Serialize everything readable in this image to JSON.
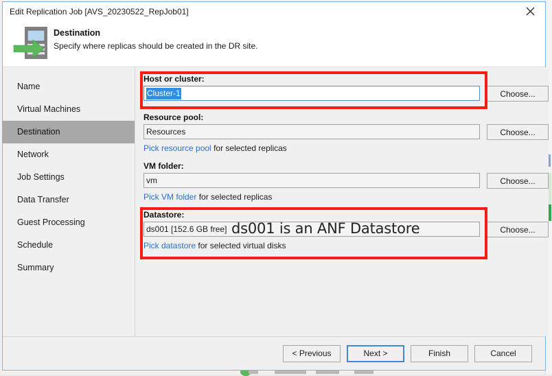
{
  "window": {
    "title": "Edit Replication Job [AVS_20230522_RepJob01]",
    "close_icon": "close-icon"
  },
  "header": {
    "icon": "replication-server-arrow-icon",
    "title": "Destination",
    "subtitle": "Specify where replicas should be created in the DR site."
  },
  "sidebar": {
    "items": [
      {
        "label": "Name",
        "active": false
      },
      {
        "label": "Virtual Machines",
        "active": false
      },
      {
        "label": "Destination",
        "active": true
      },
      {
        "label": "Network",
        "active": false
      },
      {
        "label": "Job Settings",
        "active": false
      },
      {
        "label": "Data Transfer",
        "active": false
      },
      {
        "label": "Guest Processing",
        "active": false
      },
      {
        "label": "Schedule",
        "active": false
      },
      {
        "label": "Summary",
        "active": false
      }
    ]
  },
  "form": {
    "host_cluster": {
      "label": "Host or cluster:",
      "value": "Cluster-1",
      "choose_label": "Choose...",
      "highlighted": true
    },
    "resource_pool": {
      "label": "Resource pool:",
      "value": "Resources",
      "choose_label": "Choose...",
      "hint_link": "Pick resource pool",
      "hint_rest": "for selected replicas"
    },
    "vm_folder": {
      "label": "VM folder:",
      "value": "vm",
      "choose_label": "Choose...",
      "hint_link": "Pick VM folder",
      "hint_rest": "for selected replicas"
    },
    "datastore": {
      "label": "Datastore:",
      "value": "ds001 [152.6 GB free]",
      "choose_label": "Choose...",
      "hint_link": "Pick datastore",
      "hint_rest": "for selected virtual disks",
      "annotation": "ds001 is an ANF Datastore",
      "highlighted": true
    }
  },
  "footer": {
    "previous_label": "< Previous",
    "next_label": "Next >",
    "finish_label": "Finish",
    "cancel_label": "Cancel"
  },
  "colors": {
    "annotation_red": "#f71b16",
    "selection_blue": "#2f8fe0",
    "link_blue": "#2b6fc4",
    "window_border": "#7eb4e2",
    "active_nav": "#a8a8a8"
  }
}
